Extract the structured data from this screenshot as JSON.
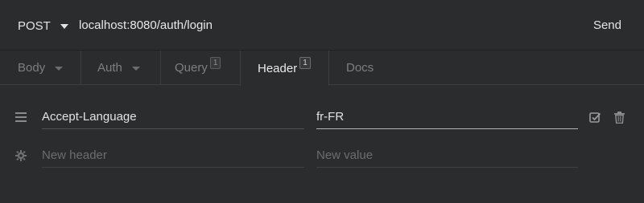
{
  "request": {
    "method": "POST",
    "url": "localhost:8080/auth/login",
    "send_label": "Send"
  },
  "tabs": [
    {
      "label": "Body"
    },
    {
      "label": "Auth"
    },
    {
      "label": "Query",
      "badge": "1"
    },
    {
      "label": "Header",
      "badge": "1"
    },
    {
      "label": "Docs"
    }
  ],
  "headers": [
    {
      "name": "Accept-Language",
      "value": "fr-FR"
    }
  ],
  "new_header": {
    "name_placeholder": "New header",
    "value_placeholder": "New value"
  },
  "colors": {
    "background": "#2b2c2e",
    "text": "#e2e2e2",
    "muted": "#7e7f82"
  }
}
